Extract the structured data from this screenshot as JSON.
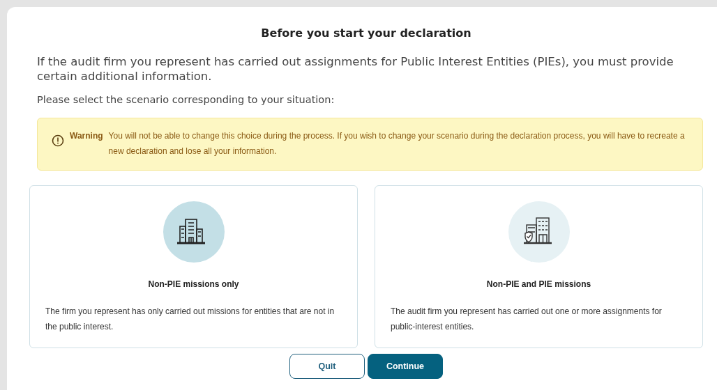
{
  "dialog": {
    "title": "Before you start your declaration",
    "intro": "If the audit firm you represent has carried out assignments for Public Interest Entities (PIEs), you must provide certain additional information.",
    "prompt": "Please select the scenario corresponding to your situation:",
    "warning": {
      "label": "Warning",
      "text": "You will not be able to change this choice during the process. If you wish to change your scenario during the declaration process, you will have to recreate a new declaration and lose all your information."
    },
    "scenarios": [
      {
        "kind": "building",
        "title": "Non-PIE missions only",
        "description": "The firm you represent has only carried out missions for entities that are not in the public interest.",
        "selected": true
      },
      {
        "kind": "shield-building",
        "title": "Non-PIE and PIE missions",
        "description": "The audit firm you represent has carried out one or more assignments for public-interest entities.",
        "selected": false
      }
    ],
    "buttons": [
      {
        "kind": "secondary",
        "label": "Quit"
      },
      {
        "kind": "primary",
        "label": "Continue"
      }
    ]
  }
}
